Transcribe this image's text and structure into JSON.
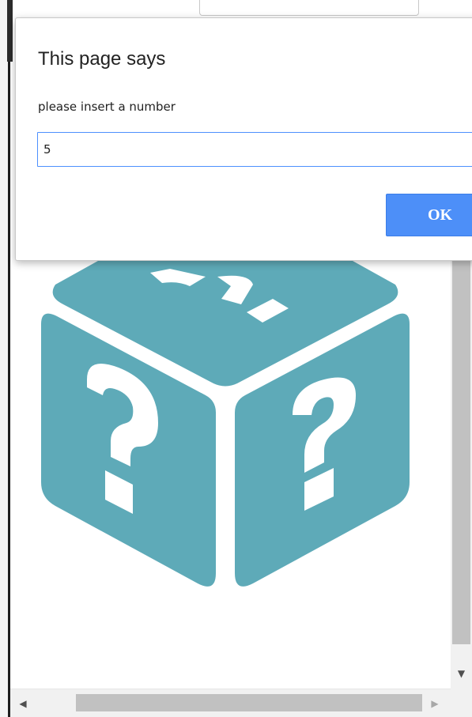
{
  "dialog": {
    "title": "This page says",
    "message": "please insert a number",
    "input_value": "5",
    "ok_label": "OK"
  },
  "page": {
    "image_icon": "question-cube-icon"
  },
  "scrollbars": {
    "down_arrow": "▼",
    "left_arrow": "◀",
    "right_arrow": "▶"
  },
  "colors": {
    "accent": "#4d8ff8",
    "cube": "#5eaab8"
  }
}
